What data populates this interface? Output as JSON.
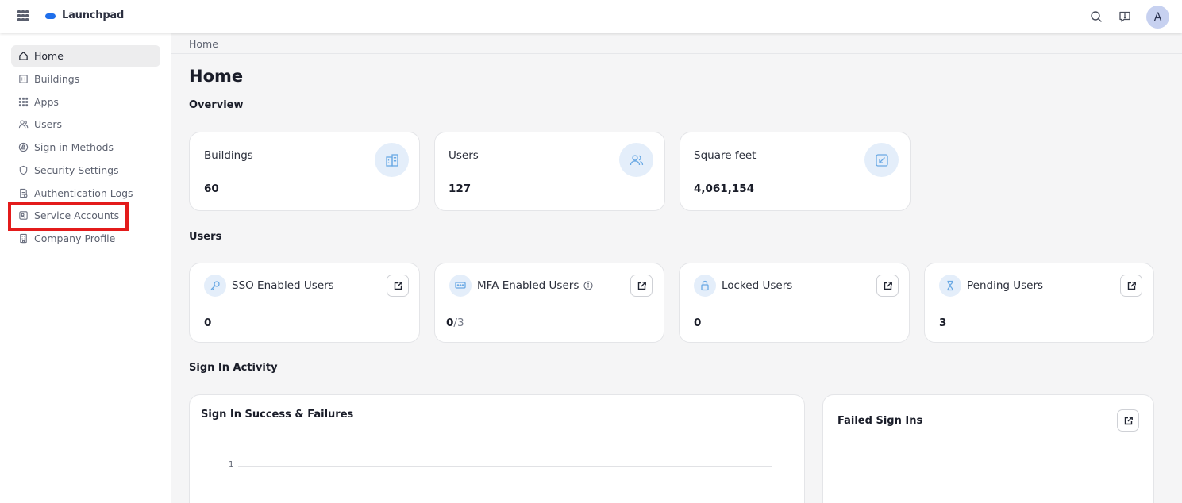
{
  "app": {
    "title": "Launchpad",
    "user_initial": "A"
  },
  "sidebar": {
    "items": [
      {
        "label": "Home",
        "icon": "home-icon",
        "active": true
      },
      {
        "label": "Buildings",
        "icon": "buildings-icon"
      },
      {
        "label": "Apps",
        "icon": "apps-icon"
      },
      {
        "label": "Users",
        "icon": "users-icon"
      },
      {
        "label": "Sign in Methods",
        "icon": "sign-in-methods-icon"
      },
      {
        "label": "Security Settings",
        "icon": "shield-icon"
      },
      {
        "label": "Authentication Logs",
        "icon": "log-icon"
      },
      {
        "label": "Service Accounts",
        "icon": "service-accounts-icon",
        "highlighted": true
      },
      {
        "label": "Company Profile",
        "icon": "company-icon"
      }
    ]
  },
  "breadcrumb": "Home",
  "page_title": "Home",
  "overview": {
    "heading": "Overview",
    "cards": [
      {
        "label": "Buildings",
        "value": "60",
        "icon": "building-icon"
      },
      {
        "label": "Users",
        "value": "127",
        "icon": "users-icon"
      },
      {
        "label": "Square feet",
        "value": "4,061,154",
        "icon": "resize-icon"
      }
    ]
  },
  "users_section": {
    "heading": "Users",
    "cards": [
      {
        "label": "SSO Enabled Users",
        "value": "0",
        "icon": "key-icon"
      },
      {
        "label": "MFA Enabled Users",
        "value": "0",
        "value_suffix": "/3",
        "icon": "mfa-icon",
        "has_info": true
      },
      {
        "label": "Locked Users",
        "value": "0",
        "icon": "lock-icon"
      },
      {
        "label": "Pending Users",
        "value": "3",
        "icon": "hourglass-icon"
      }
    ]
  },
  "sign_in_activity": {
    "heading": "Sign In Activity",
    "success_failures_title": "Sign In Success & Failures",
    "failed_title": "Failed Sign Ins"
  },
  "chart_data": {
    "type": "line",
    "title": "Sign In Success & Failures",
    "y_ticks": [
      "1"
    ]
  },
  "colors": {
    "accent": "#1f6feb",
    "icon_bubble": "#e4eefa",
    "icon_stroke": "#6aa9e4",
    "highlight": "#e31b1b"
  }
}
